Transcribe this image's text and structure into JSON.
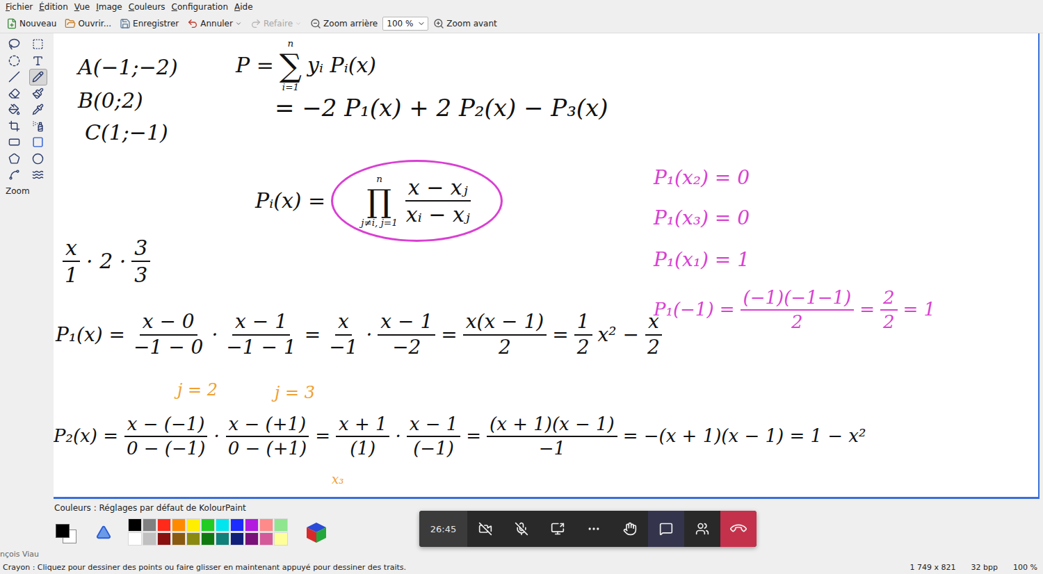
{
  "window": {
    "menu": [
      "Fichier",
      "Édition",
      "Vue",
      "Image",
      "Couleurs",
      "Configuration",
      "Aide"
    ]
  },
  "toolbar": {
    "items": [
      {
        "kind": "button",
        "label": "Nouveau",
        "disabled": false,
        "dropdown": false
      },
      {
        "kind": "button",
        "label": "Ouvrir...",
        "disabled": false,
        "dropdown": false
      },
      {
        "kind": "button",
        "label": "Enregistrer",
        "disabled": false,
        "dropdown": false
      },
      {
        "kind": "button",
        "label": "Annuler",
        "disabled": false,
        "dropdown": true
      },
      {
        "kind": "button",
        "label": "Refaire",
        "disabled": true,
        "dropdown": true
      },
      {
        "kind": "button",
        "label": "Zoom arrière",
        "disabled": false,
        "dropdown": false
      },
      {
        "kind": "combo",
        "label": "100 %",
        "disabled": false,
        "dropdown": true
      },
      {
        "kind": "button",
        "label": "Zoom avant",
        "disabled": false,
        "dropdown": false
      }
    ]
  },
  "toolbox": {
    "tools": [
      {
        "selected": false
      },
      {
        "selected": false
      },
      {
        "selected": false
      },
      {
        "selected": false
      },
      {
        "selected": false
      },
      {
        "selected": true
      },
      {
        "selected": false
      },
      {
        "selected": false
      },
      {
        "selected": false
      },
      {
        "selected": false
      },
      {
        "selected": false
      },
      {
        "selected": false
      },
      {
        "selected": false
      },
      {
        "selected": false
      },
      {
        "selected": false
      },
      {
        "selected": false
      },
      {
        "selected": false
      },
      {
        "selected": false
      }
    ],
    "label": "Zoom"
  },
  "canvas": {
    "marks": [
      {
        "color": "#111111",
        "parts": [
          {
            "kind": "text",
            "text": "A(−1;−2)"
          }
        ]
      },
      {
        "color": "#111111",
        "parts": [
          {
            "kind": "text",
            "text": "B(0;2)"
          }
        ]
      },
      {
        "color": "#111111",
        "parts": [
          {
            "kind": "text",
            "text": "C(1;−1)"
          }
        ]
      },
      {
        "color": "#111111",
        "parts": [
          {
            "kind": "text",
            "text": "P ="
          },
          {
            "kind": "bigop",
            "op": "∑",
            "over": "n",
            "under": "i=1"
          },
          {
            "kind": "text",
            "text": "yᵢ Pᵢ(x)"
          }
        ]
      },
      {
        "color": "#111111",
        "parts": [
          {
            "kind": "text",
            "text": "= −2 P₁(x) + 2 P₂(x) − P₃(x)"
          }
        ]
      },
      {
        "color": "#111111",
        "parts": [
          {
            "kind": "text",
            "text": "Pᵢ(x) ="
          },
          {
            "kind": "group",
            "circled": true,
            "color": "#d93fd3",
            "parts": [
              {
                "kind": "bigop",
                "op": "∏",
                "over": "n",
                "under": "j≠i, j=1"
              },
              {
                "kind": "frac",
                "num": "x − xⱼ",
                "den": "xᵢ − xⱼ"
              }
            ]
          }
        ]
      },
      {
        "color": "#111111",
        "parts": [
          {
            "kind": "frac",
            "num": "x",
            "den": "1"
          },
          {
            "kind": "text",
            "text": "· 2 ·"
          },
          {
            "kind": "frac",
            "num": "3",
            "den": "3"
          }
        ]
      },
      {
        "color": "#d93fd3",
        "parts": [
          {
            "kind": "text",
            "text": "P₁(x₂) = 0"
          }
        ]
      },
      {
        "color": "#d93fd3",
        "parts": [
          {
            "kind": "text",
            "text": "P₁(x₃) = 0"
          }
        ]
      },
      {
        "color": "#d93fd3",
        "parts": [
          {
            "kind": "text",
            "text": "P₁(x₁) = 1"
          }
        ]
      },
      {
        "color": "#d93fd3",
        "parts": [
          {
            "kind": "text",
            "text": "P₁(−1) ="
          },
          {
            "kind": "frac",
            "num": "(−1)(−1−1)",
            "den": "2"
          },
          {
            "kind": "text",
            "text": "="
          },
          {
            "kind": "frac",
            "num": "2",
            "den": "2"
          },
          {
            "kind": "text",
            "text": "= 1"
          }
        ]
      },
      {
        "color": "#111111",
        "parts": [
          {
            "kind": "text",
            "text": "P₁(x) ="
          },
          {
            "kind": "frac",
            "num": "x − 0",
            "den": "−1 − 0"
          },
          {
            "kind": "text",
            "text": "·"
          },
          {
            "kind": "frac",
            "num": "x − 1",
            "den": "−1 − 1"
          },
          {
            "kind": "text",
            "text": "="
          },
          {
            "kind": "frac",
            "num": "x",
            "den": "−1"
          },
          {
            "kind": "text",
            "text": "·"
          },
          {
            "kind": "frac",
            "num": "x − 1",
            "den": "−2"
          },
          {
            "kind": "text",
            "text": "="
          },
          {
            "kind": "frac",
            "num": "x(x − 1)",
            "den": "2"
          },
          {
            "kind": "text",
            "text": "="
          },
          {
            "kind": "frac",
            "num": "1",
            "den": "2"
          },
          {
            "kind": "text",
            "text": "x² −"
          },
          {
            "kind": "frac",
            "num": "x",
            "den": "2"
          }
        ]
      },
      {
        "color": "#f0a030",
        "parts": [
          {
            "kind": "text",
            "text": "j = 2"
          }
        ]
      },
      {
        "color": "#f0a030",
        "parts": [
          {
            "kind": "text",
            "text": "j = 3"
          }
        ]
      },
      {
        "color": "#111111",
        "parts": [
          {
            "kind": "text",
            "text": "P₂(x) ="
          },
          {
            "kind": "frac",
            "num": "x − (−1)",
            "den": "0 − (−1)"
          },
          {
            "kind": "text",
            "text": "·"
          },
          {
            "kind": "frac",
            "num": "x − (+1)",
            "den": "0 − (+1)"
          },
          {
            "kind": "text",
            "text": "="
          },
          {
            "kind": "frac",
            "num": "x + 1",
            "den": "(1)"
          },
          {
            "kind": "text",
            "text": "·"
          },
          {
            "kind": "frac",
            "num": "x − 1",
            "den": "(−1)"
          },
          {
            "kind": "text",
            "text": "="
          },
          {
            "kind": "frac",
            "num": "(x + 1)(x − 1)",
            "den": "−1"
          },
          {
            "kind": "text",
            "text": "= −(x + 1)(x − 1) = 1 − x²"
          }
        ]
      },
      {
        "color": "#f0a030",
        "parts": [
          {
            "kind": "text",
            "text": "x₃"
          }
        ]
      }
    ]
  },
  "colors": {
    "title": "Couleurs : Réglages par défaut de KolourPaint",
    "foreground": "#000000",
    "background": "#ffffff",
    "palette": [
      {
        "color": "#000000"
      },
      {
        "color": "#808080"
      },
      {
        "color": "#ff2a1a"
      },
      {
        "color": "#ff8a00"
      },
      {
        "color": "#ffee00"
      },
      {
        "color": "#22cc22"
      },
      {
        "color": "#00e5ee"
      },
      {
        "color": "#1a2cff"
      },
      {
        "color": "#b21ae0"
      },
      {
        "color": "#ff8a8a"
      },
      {
        "color": "#8ee68e"
      },
      {
        "color": "#ffffff"
      },
      {
        "color": "#c0c0c0"
      },
      {
        "color": "#8a1010"
      },
      {
        "color": "#8a5a10"
      },
      {
        "color": "#8a8a10"
      },
      {
        "color": "#107a10"
      },
      {
        "color": "#10807a"
      },
      {
        "color": "#10207a"
      },
      {
        "color": "#7a107a"
      },
      {
        "color": "#d45a9a"
      },
      {
        "color": "#ffff9a"
      }
    ]
  },
  "call": {
    "timer": "26:45",
    "camera_on": false,
    "mic_on": false,
    "chat_selected": true,
    "participant": "nçois Viau"
  },
  "status_bar": {
    "message": "Crayon : Cliquez pour dessiner des points ou faire glisser en maintenant appuyé pour dessiner des traits.",
    "size": "1 749 x 821",
    "depth": "32 bpp",
    "zoom": "100 %"
  }
}
